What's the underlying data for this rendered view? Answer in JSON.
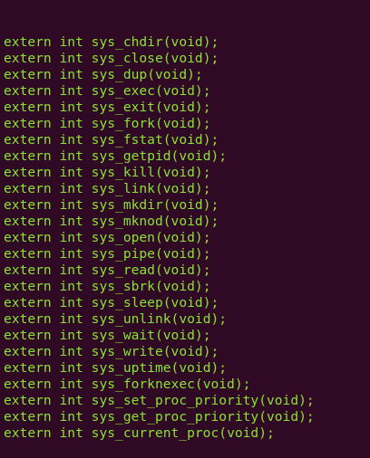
{
  "terminal": {
    "keyword": "extern",
    "return_type": "int",
    "param": "void",
    "lines": [
      {
        "func": "sys_chdir"
      },
      {
        "func": "sys_close"
      },
      {
        "func": "sys_dup"
      },
      {
        "func": "sys_exec"
      },
      {
        "func": "sys_exit"
      },
      {
        "func": "sys_fork"
      },
      {
        "func": "sys_fstat"
      },
      {
        "func": "sys_getpid"
      },
      {
        "func": "sys_kill"
      },
      {
        "func": "sys_link"
      },
      {
        "func": "sys_mkdir"
      },
      {
        "func": "sys_mknod"
      },
      {
        "func": "sys_open"
      },
      {
        "func": "sys_pipe"
      },
      {
        "func": "sys_read"
      },
      {
        "func": "sys_sbrk"
      },
      {
        "func": "sys_sleep"
      },
      {
        "func": "sys_unlink"
      },
      {
        "func": "sys_wait"
      },
      {
        "func": "sys_write"
      },
      {
        "func": "sys_uptime"
      },
      {
        "func": "sys_forknexec"
      },
      {
        "func": "sys_set_proc_priority"
      },
      {
        "func": "sys_get_proc_priority"
      },
      {
        "func": "sys_current_proc"
      }
    ]
  },
  "colors": {
    "background": "#300a24",
    "code_text": "#8ae234"
  }
}
